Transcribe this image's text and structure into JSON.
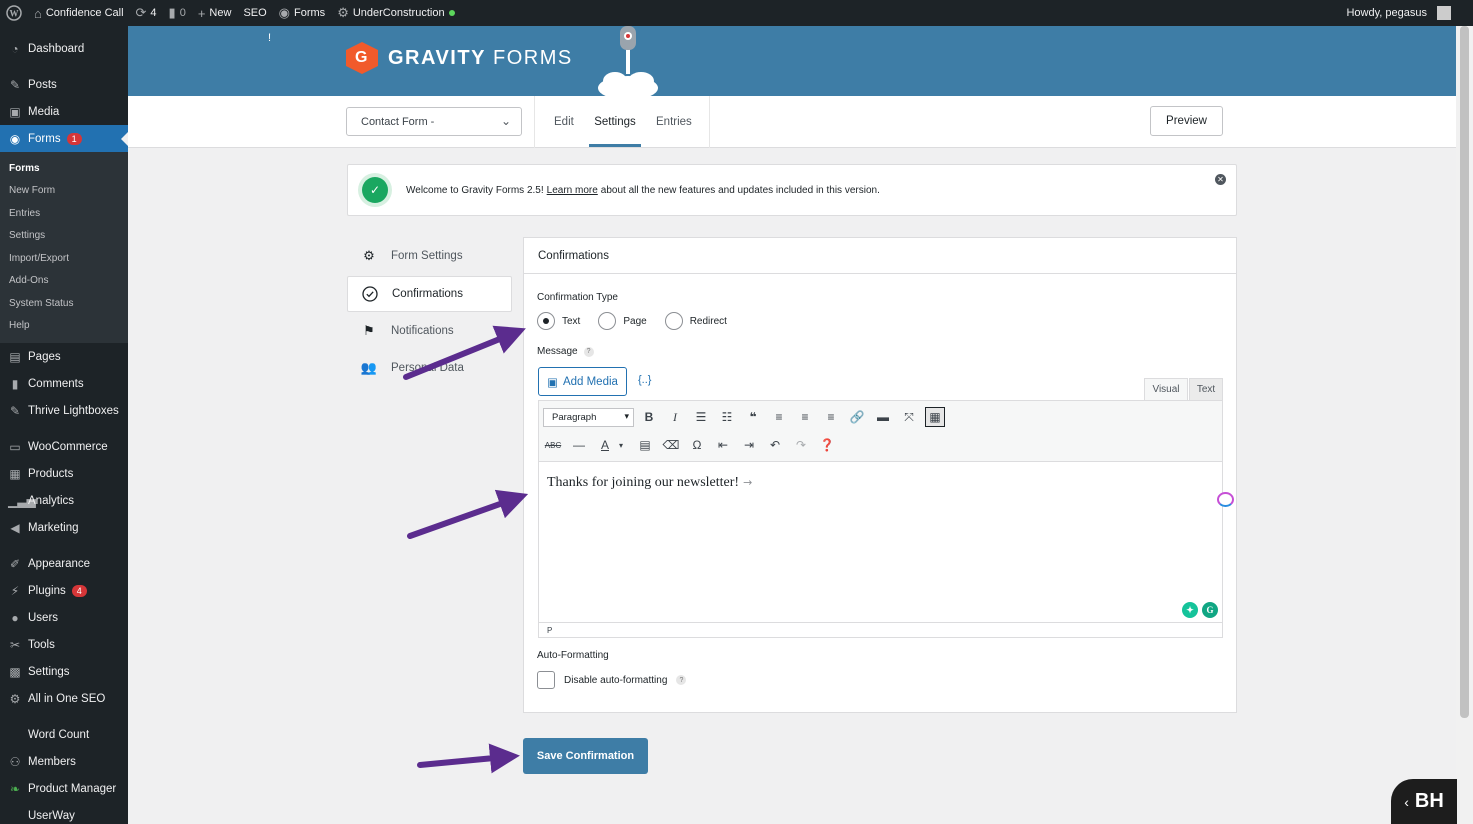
{
  "adminbar": {
    "site": "Confidence Call",
    "updates": "4",
    "comments": "0",
    "new": "New",
    "seo": "SEO",
    "forms": "Forms",
    "status": "UnderConstruction",
    "howdy": "Howdy, pegasus"
  },
  "sidebar": {
    "items": [
      {
        "label": "Dashboard",
        "icon": "dashboard-icon"
      },
      {
        "label": "Posts",
        "icon": "pin-icon"
      },
      {
        "label": "Media",
        "icon": "media-icon"
      },
      {
        "label": "Forms",
        "icon": "forms-icon",
        "badge": "1"
      },
      {
        "label": "Pages",
        "icon": "pages-icon"
      },
      {
        "label": "Comments",
        "icon": "comments-icon"
      },
      {
        "label": "Thrive Lightboxes",
        "icon": "pin-icon"
      },
      {
        "label": "WooCommerce",
        "icon": "woo-icon"
      },
      {
        "label": "Products",
        "icon": "products-icon"
      },
      {
        "label": "Analytics",
        "icon": "analytics-icon"
      },
      {
        "label": "Marketing",
        "icon": "marketing-icon"
      },
      {
        "label": "Appearance",
        "icon": "brush-icon"
      },
      {
        "label": "Plugins",
        "icon": "plugins-icon",
        "badge": "4"
      },
      {
        "label": "Users",
        "icon": "users-icon"
      },
      {
        "label": "Tools",
        "icon": "tools-icon"
      },
      {
        "label": "Settings",
        "icon": "settings-icon"
      },
      {
        "label": "All in One SEO",
        "icon": "seo-icon"
      },
      {
        "label": "Word Count",
        "icon": ""
      },
      {
        "label": "Members",
        "icon": "members-icon"
      },
      {
        "label": "Product Manager",
        "icon": "leaf-icon"
      },
      {
        "label": "UserWay",
        "icon": ""
      }
    ],
    "submenu": [
      "Forms",
      "New Form",
      "Entries",
      "Settings",
      "Import/Export",
      "Add-Ons",
      "System Status",
      "Help"
    ]
  },
  "header": {
    "logo_bold": "GRAVITY",
    "logo_light": "FORMS",
    "logo_letter": "G",
    "mark": "!"
  },
  "toolbar": {
    "form_select": "Contact Form -",
    "tabs": [
      "Edit",
      "Settings",
      "Entries"
    ],
    "preview": "Preview"
  },
  "notice": {
    "text_before": "Welcome to Gravity Forms 2.5!",
    "link": "Learn more",
    "text_after": "about all the new features and updates included in this version."
  },
  "settings_nav": [
    "Form Settings",
    "Confirmations",
    "Notifications",
    "Personal Data"
  ],
  "panel": {
    "title": "Confirmations",
    "confirmation_type_label": "Confirmation Type",
    "radios": [
      "Text",
      "Page",
      "Redirect"
    ],
    "selected_radio": "Text",
    "message_label": "Message",
    "add_media": "Add Media",
    "merge_tag": "{..}",
    "editor_tabs": [
      "Visual",
      "Text"
    ],
    "format_select": "Paragraph",
    "editor_content": "Thanks for joining our newsletter!",
    "editor_status": "P",
    "auto_formatting_label": "Auto-Formatting",
    "disable_auto_formatting": "Disable auto-formatting",
    "help": "?"
  },
  "save_button": "Save Confirmation",
  "bh_badge": "BH",
  "colors": {
    "accent": "#3e7da6",
    "wp_blue": "#2271b1",
    "sidebar_bg": "#1d2327",
    "annotation_arrow": "#5b2c8e",
    "success": "#1aa760",
    "badge": "#d63638"
  }
}
